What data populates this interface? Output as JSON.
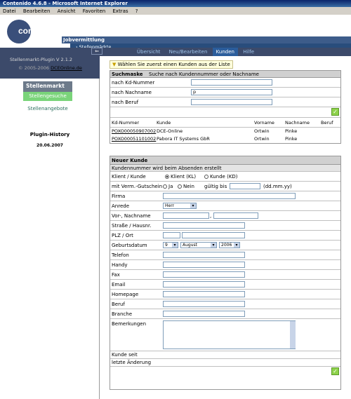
{
  "window": {
    "title": "Contenido 4.6.8 - Microsoft Internet Explorer"
  },
  "menu": [
    "Datei",
    "Bearbeiten",
    "Ansicht",
    "Favoriten",
    "Extras",
    "?"
  ],
  "header": {
    "logo": "contenido",
    "section": "Jobvermittlung",
    "breadcrumb": "› Stellenmärkte"
  },
  "sidebar": {
    "plugin_version": "Stellenmarkt-Plugin V 2.1.2",
    "copyright_prefix": "© 2005-2006",
    "copyright_link": "DCEOnline.de",
    "nav_head": "Stellenmarkt",
    "nav_active": "Stellengesuche",
    "nav_item": "Stellenangebote",
    "history_title": "Plugin-History",
    "history_date": "20.06.2007"
  },
  "tabs": [
    "Übersicht",
    "Neu/Bearbeiten",
    "Kunden",
    "Hilfe"
  ],
  "hint": "Wählen Sie zuerst einen Kunden aus der Liste",
  "search": {
    "title": "Suchmaske",
    "subtitle": "Suche nach Kundennummer oder Nachname",
    "label_kd": "nach Kd-Nummer",
    "label_name": "nach Nachname",
    "label_beruf": "nach Beruf",
    "value_name": "p"
  },
  "results": {
    "headers": [
      "Kd-Nummer",
      "Kunde",
      "Vorname",
      "Nachname",
      "Beruf"
    ],
    "rows": [
      [
        "POXO00050907002",
        "DCE-Online",
        "Ortwin",
        "Pinke",
        ""
      ],
      [
        "POXO00051101002",
        "Pabora IT Systems GbR",
        "Ortwin",
        "Pinke",
        ""
      ]
    ]
  },
  "kunde": {
    "title": "Neuer Kunde",
    "note": "Kundennummer wird beim Absenden erstellt",
    "klient_label": "Klient / Kunde",
    "opt_klient": "Klient (KL)",
    "opt_kunde": "Kunde (KD)",
    "verm_label": "mit Verm.-Gutschein",
    "opt_ja": "Ja",
    "opt_nein": "Nein",
    "gueltig": "gültig bis",
    "datefmt": "(dd.mm.yy)",
    "firma": "Firma",
    "anrede": "Anrede",
    "anrede_value": "Herr",
    "vorname": "Vor-, Nachname",
    "comma": ",",
    "strasse": "Straße / Hausnr.",
    "plz": "PLZ / Ort",
    "geburt": "Geburtsdatum",
    "day": "9",
    "month": "August",
    "year": "2006",
    "telefon": "Telefon",
    "handy": "Handy",
    "fax": "Fax",
    "email": "Email",
    "homepage": "Homepage",
    "beruf": "Beruf",
    "branche": "Branche",
    "bemerkungen": "Bemerkungen",
    "kunde_seit": "Kunde seit",
    "letzte": "letzte Änderung"
  }
}
